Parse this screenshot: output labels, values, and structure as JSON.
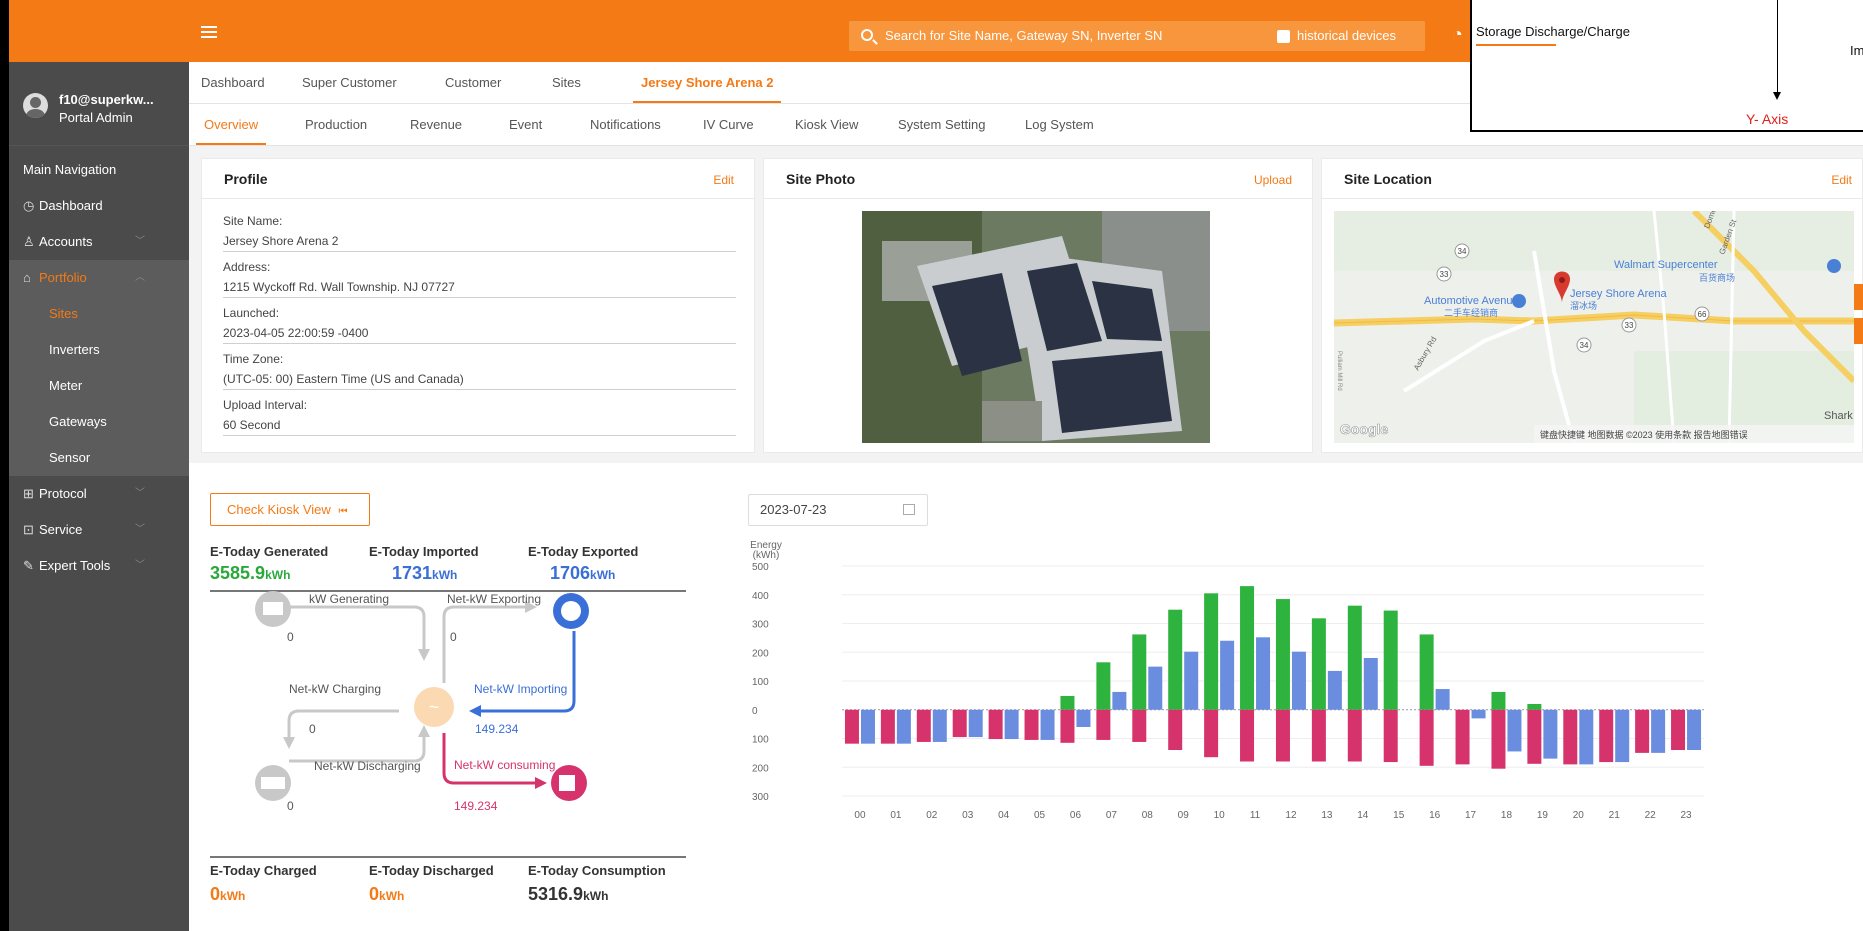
{
  "header": {
    "search_placeholder": "Search for Site Name, Gateway SN, Inverter SN",
    "historical_label": "historical devices",
    "accent_color": "#f47a16"
  },
  "user": {
    "name": "f10@superkw...",
    "role": "Portal Admin"
  },
  "sidebar": {
    "section": "Main Navigation",
    "items": [
      {
        "label": "Dashboard",
        "icon": "dashboard-icon"
      },
      {
        "label": "Accounts",
        "icon": "user-icon"
      },
      {
        "label": "Portfolio",
        "icon": "home-icon"
      },
      {
        "label": "Sites"
      },
      {
        "label": "Inverters"
      },
      {
        "label": "Meter"
      },
      {
        "label": "Gateways"
      },
      {
        "label": "Sensor"
      },
      {
        "label": "Protocol",
        "icon": "grid-icon"
      },
      {
        "label": "Service",
        "icon": "service-icon"
      },
      {
        "label": "Expert Tools",
        "icon": "wrench-icon"
      }
    ]
  },
  "tabs_top": [
    "Dashboard",
    "Super Customer",
    "Customer",
    "Sites",
    "Jersey Shore Arena 2"
  ],
  "tabs_sub": [
    "Overview",
    "Production",
    "Revenue",
    "Event",
    "Notifications",
    "IV Curve",
    "Kiosk View",
    "System Setting",
    "Log System"
  ],
  "profile": {
    "title": "Profile",
    "edit": "Edit",
    "fields": [
      {
        "label": "Site Name:",
        "value": "Jersey Shore Arena 2"
      },
      {
        "label": "Address:",
        "value": "1215 Wyckoff Rd. Wall Township. NJ 07727"
      },
      {
        "label": "Launched:",
        "value": "2023-04-05 22:00:59 -0400"
      },
      {
        "label": "Time Zone:",
        "value": "(UTC-05: 00) Eastern Time  (US and Canada)"
      },
      {
        "label": "Upload Interval:",
        "value": "60 Second"
      }
    ]
  },
  "photo": {
    "title": "Site Photo",
    "upload": "Upload"
  },
  "location": {
    "title": "Site Location",
    "edit": "Edit",
    "labels": {
      "walmart": "Walmart Supercenter",
      "walmart_cn": "百货商场",
      "auto": "Automotive Avenues",
      "auto_cn": "二手车经销商",
      "arena": "Jersey Shore Arena",
      "arena_cn": "溜冰场",
      "shark": "Shark",
      "google": "Google",
      "footer": "键盘快捷键   地图数据 ©2023   使用条款   报告地图错误",
      "r34": "34",
      "r33": "33",
      "r66": "66",
      "asbury": "Asbury Rd",
      "dome": "Dome",
      "garden": "Garden St",
      "pulliam": "Pulliam Mill Rd"
    }
  },
  "energy": {
    "kiosk_button": "Check Kiosk View",
    "generated_label": "E-Today Generated",
    "generated_value": "3585.9",
    "imported_label": "E-Today Imported",
    "imported_value": "1731",
    "exported_label": "E-Today Exported",
    "exported_value": "1706",
    "charged_label": "E-Today Charged",
    "charged_value": "0",
    "discharged_label": "E-Today Discharged",
    "discharged_value": "0",
    "consumption_label": "E-Today Consumption",
    "consumption_value": "5316.9",
    "unit": "kWh",
    "colors": {
      "generated": "#2aa83c",
      "imported": "#3a6fd8",
      "exported": "#3a6fd8",
      "charged": "#f47a16",
      "consumption": "#333333"
    }
  },
  "flow": {
    "kw_generating": "kW Generating",
    "net_exporting": "Net-kW  Exporting",
    "net_charging": "Net-kW  Charging",
    "net_importing": "Net-kW  Importing",
    "net_discharging": "Net-kW  Discharging",
    "net_consuming": "Net-kW  consuming",
    "gen_value": "0",
    "export_value": "0",
    "charge_value": "0",
    "discharge_value": "0",
    "import_value": "149.234",
    "consume_value": "149.234"
  },
  "date": "2023-07-23",
  "chart_data": {
    "type": "bar",
    "ylabel": "Energy\n(kWh)",
    "ylim": [
      -300,
      500
    ],
    "yticks": [
      500,
      400,
      300,
      200,
      100,
      0,
      -100,
      -200,
      -300
    ],
    "ytick_labels": [
      "500",
      "400",
      "300",
      "200",
      "100",
      "0",
      "100",
      "200",
      "300"
    ],
    "categories": [
      "00",
      "01",
      "02",
      "03",
      "04",
      "05",
      "06",
      "07",
      "08",
      "09",
      "10",
      "11",
      "12",
      "13",
      "14",
      "15",
      "16",
      "17",
      "18",
      "19",
      "20",
      "21",
      "22",
      "23"
    ],
    "series": [
      {
        "color": "#2fb33f",
        "values": [
          0,
          0,
          0,
          0,
          0,
          0,
          48,
          165,
          262,
          348,
          405,
          430,
          385,
          318,
          362,
          345,
          262,
          0,
          62,
          20,
          0,
          0,
          0,
          0
        ]
      },
      {
        "color": "#d6336c",
        "values": [
          -118,
          -118,
          -112,
          -95,
          -102,
          -105,
          -115,
          -105,
          -112,
          -140,
          -165,
          -180,
          -180,
          -180,
          -180,
          -182,
          -195,
          -190,
          -205,
          -188,
          -190,
          -182,
          -150,
          -140
        ]
      },
      {
        "color": "#6a8de0",
        "values": [
          -118,
          -118,
          -112,
          -95,
          -102,
          -105,
          -60,
          62,
          150,
          202,
          240,
          252,
          202,
          135,
          180,
          0,
          72,
          -30,
          -145,
          -170,
          -190,
          -182,
          -150,
          -140
        ]
      }
    ]
  },
  "annotation": {
    "text": "Storage Discharge/Charge",
    "axis": "Y- Axis",
    "cut_text": "Im"
  }
}
